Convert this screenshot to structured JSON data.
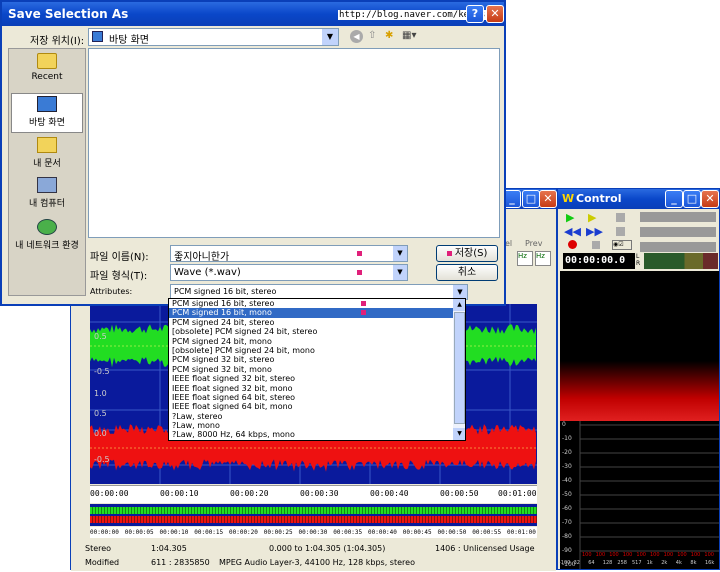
{
  "dialog": {
    "title": "Save Selection As",
    "url_overlay": "http://blog.naver.com/kentsh2",
    "save_in_label": "저장 위치(I):",
    "save_in_value": "바탕 화면",
    "places": [
      {
        "label": "Recent",
        "icon": "recent-folder-icon"
      },
      {
        "label": "바탕 화면",
        "icon": "desktop-icon"
      },
      {
        "label": "내 문서",
        "icon": "my-documents-icon"
      },
      {
        "label": "내 컴퓨터",
        "icon": "my-computer-icon"
      },
      {
        "label": "내 네트워크 환경",
        "icon": "network-icon"
      }
    ],
    "filename_label": "파일 이름(N):",
    "filename_value": "좋지아니한가",
    "filetype_label": "파일 형식(T):",
    "filetype_value": "Wave (*.wav)",
    "save_button": "저장(S)",
    "cancel_button": "취소",
    "attributes_label": "Attributes:",
    "attributes_value": "PCM signed 16 bit, stereo",
    "attribute_options": [
      "PCM signed 16 bit, stereo",
      "PCM signed 16 bit, mono",
      "PCM signed 24 bit, stereo",
      "[obsolete] PCM signed 24 bit, stereo",
      "PCM signed 24 bit, mono",
      "[obsolete] PCM signed 24 bit, mono",
      "PCM signed 32 bit, stereo",
      "PCM signed 32 bit, mono",
      "IEEE float signed 32 bit, stereo",
      "IEEE float signed 32 bit, mono",
      "IEEE float signed 64 bit, stereo",
      "IEEE float signed 64 bit, mono",
      "?Law, stereo",
      "?Law, mono",
      "?Law, 8000 Hz, 64 kbps, mono"
    ],
    "selected_option_index": 1
  },
  "editor": {
    "toolbar_labels": [
      "el",
      "Prev"
    ],
    "channel_scale_top": [
      "0.5",
      "-0.5"
    ],
    "channel_scale_bottom": [
      "1.0",
      "0.5",
      "0.0",
      "-0.5"
    ],
    "timeline": [
      "00:00:00",
      "00:00:10",
      "00:00:20",
      "00:00:30",
      "00:00:40",
      "00:00:50",
      "00:01:00"
    ],
    "overview_timeline": [
      "00:00:00",
      "00:00:05",
      "00:00:10",
      "00:00:15",
      "00:00:20",
      "00:00:25",
      "00:00:30",
      "00:00:35",
      "00:00:40",
      "00:00:45",
      "00:00:50",
      "00:00:55",
      "00:01:00"
    ],
    "status": {
      "row1": [
        "Stereo",
        "1:04.305",
        "0.000 to 1:04.305 (1:04.305)",
        "1406 : Unlicensed Usage"
      ],
      "row2": [
        "Modified",
        "611 : 2835850",
        "MPEG Audio Layer-3, 44100 Hz, 128 kbps, stereo"
      ]
    }
  },
  "control": {
    "title": "Control",
    "time": "00:00:00.0",
    "lr_labels": [
      "L",
      "R"
    ],
    "db_scale": [
      "0",
      "-10",
      "-20",
      "-30",
      "-40",
      "-50",
      "-60",
      "-70",
      "-80",
      "-90",
      "-100"
    ],
    "freq_labels": [
      "-100",
      "32",
      "64",
      "128",
      "258",
      "517",
      "1k",
      "2k",
      "4k",
      "8k",
      "16k"
    ],
    "peak_labels": [
      "100",
      "100",
      "100",
      "100",
      "100",
      "100",
      "100",
      "100",
      "100",
      "100"
    ]
  },
  "colors": {
    "xp_blue": "#0a47c9",
    "wave_green": "#22dd22",
    "wave_red": "#ee1111",
    "wave_bg": "#0a1a9c"
  }
}
